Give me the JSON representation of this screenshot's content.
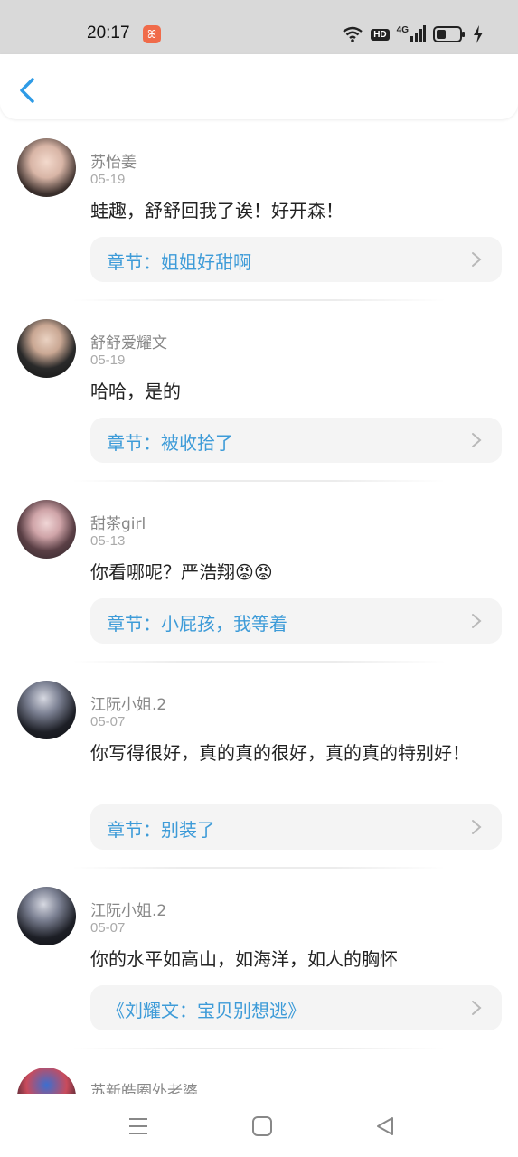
{
  "status_bar": {
    "time": "20:17",
    "app_badge": "ꕤ",
    "hd": "HD",
    "net": "4G"
  },
  "header": {
    "back_icon": "chevron-left-icon"
  },
  "comments": [
    {
      "name": "苏怡姜",
      "date": "05-19",
      "text": "蛙趣，舒舒回我了诶！好开森！",
      "chapter": "章节：姐姐好甜啊"
    },
    {
      "name": "舒舒爱耀文",
      "date": "05-19",
      "text": "哈哈，是的",
      "chapter": "章节：被收拾了"
    },
    {
      "name": "甜茶girl",
      "date": "05-13",
      "text": "你看哪呢？严浩翔😡😡",
      "chapter": "章节：小屁孩，我等着"
    },
    {
      "name": "江阮小姐.2",
      "date": "05-07",
      "text": "你写得很好，真的真的很好，真的真的特别好！",
      "chapter": "章节：别装了"
    },
    {
      "name": "江阮小姐.2",
      "date": "05-07",
      "text": "你的水平如高山，如海洋，如人的胸怀",
      "chapter": "《刘耀文：宝贝别想逃》"
    },
    {
      "name": "苏新皓圈外老婆",
      "date": "",
      "text": "",
      "chapter": ""
    }
  ],
  "colors": {
    "link": "#3d9bd8",
    "back": "#2e9be6",
    "card": "#f4f4f4"
  },
  "nav": {
    "menu_icon": "menu-icon",
    "home_icon": "square-home-icon",
    "back_icon": "triangle-back-icon"
  }
}
